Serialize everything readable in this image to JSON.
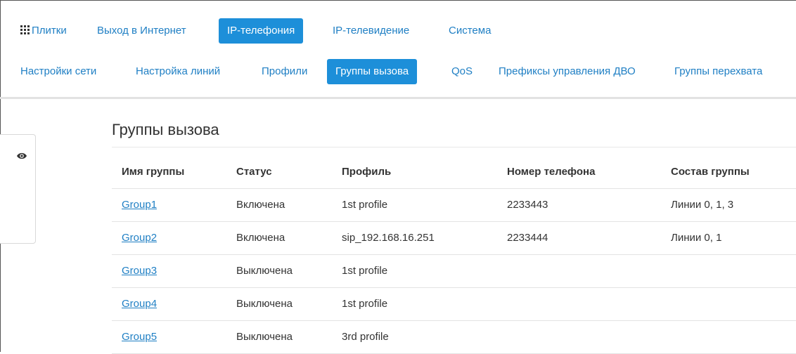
{
  "topnav": {
    "items": [
      {
        "label": "Плитки",
        "active": false
      },
      {
        "label": "Выход в Интернет",
        "active": false
      },
      {
        "label": "IP-телефония",
        "active": true
      },
      {
        "label": "IP-телевидение",
        "active": false
      },
      {
        "label": "Система",
        "active": false
      }
    ]
  },
  "subnav": {
    "items": [
      {
        "label": "Настройки сети",
        "active": false
      },
      {
        "label": "Настройка линий",
        "active": false
      },
      {
        "label": "Профили",
        "active": false
      },
      {
        "label": "Группы вызова",
        "active": true
      },
      {
        "label": "QoS",
        "active": false
      },
      {
        "label": "Префиксы управления ДВО",
        "active": false
      },
      {
        "label": "Группы перехвата",
        "active": false
      }
    ]
  },
  "side_panel": {
    "icon": "eye-icon"
  },
  "page": {
    "title": "Группы вызова"
  },
  "table": {
    "headers": [
      "Имя группы",
      "Статус",
      "Профиль",
      "Номер телефона",
      "Состав группы"
    ],
    "rows": [
      {
        "name": "Group1",
        "status": "Включена",
        "profile": "1st profile",
        "phone": "2233443",
        "members": "Линии 0, 1, 3"
      },
      {
        "name": "Group2",
        "status": "Включена",
        "profile": "sip_192.168.16.251",
        "phone": "2233444",
        "members": "Линии 0, 1"
      },
      {
        "name": "Group3",
        "status": "Выключена",
        "profile": "1st profile",
        "phone": "",
        "members": ""
      },
      {
        "name": "Group4",
        "status": "Выключена",
        "profile": "1st profile",
        "phone": "",
        "members": ""
      },
      {
        "name": "Group5",
        "status": "Выключена",
        "profile": "3rd profile",
        "phone": "",
        "members": ""
      }
    ]
  },
  "colors": {
    "accent": "#1d8fd9",
    "link": "#1f7fc4",
    "text": "#333333"
  }
}
